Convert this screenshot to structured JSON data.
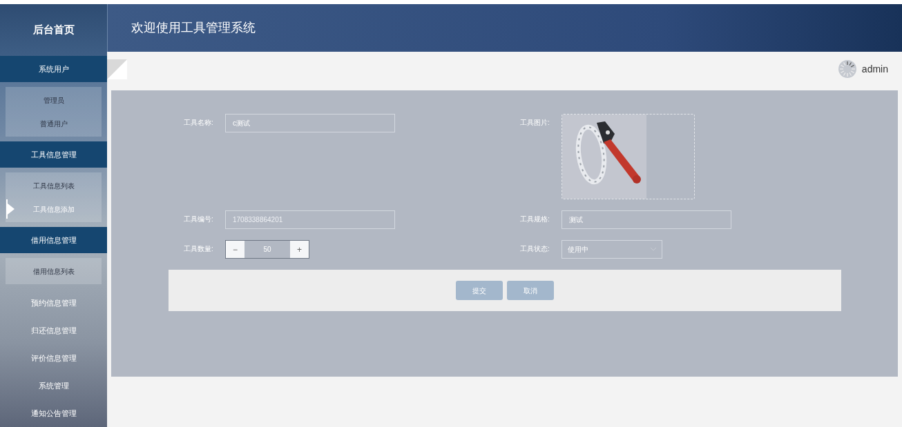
{
  "sidebar": {
    "title": "后台首页",
    "menu": [
      {
        "label": "系统用户",
        "expanded": true,
        "children": [
          {
            "label": "管理员",
            "selected": false
          },
          {
            "label": "普通用户",
            "selected": false
          }
        ]
      },
      {
        "label": "工具信息管理",
        "expanded": true,
        "children": [
          {
            "label": "工具信息列表",
            "selected": false
          },
          {
            "label": "工具信息添加",
            "selected": true
          }
        ]
      },
      {
        "label": "借用信息管理",
        "expanded": true,
        "children": [
          {
            "label": "借用信息列表",
            "selected": false
          }
        ]
      },
      {
        "label": "预约信息管理",
        "expanded": false
      },
      {
        "label": "归还信息管理",
        "expanded": false
      },
      {
        "label": "评价信息管理",
        "expanded": false
      },
      {
        "label": "系统管理",
        "expanded": false
      },
      {
        "label": "通知公告管理",
        "expanded": false
      }
    ]
  },
  "header": {
    "title": "欢迎使用工具管理系统",
    "user": "admin"
  },
  "form": {
    "rows": [
      [
        {
          "kind": "text",
          "label": "工具名称:",
          "value": "c测试",
          "disabled": false
        },
        {
          "kind": "picture",
          "label": "工具图片:"
        }
      ],
      [
        {
          "kind": "text",
          "label": "工具编号:",
          "value": "1708338864201",
          "disabled": true
        },
        {
          "kind": "text",
          "label": "工具规格:",
          "value": "测试",
          "disabled": false
        }
      ],
      [
        {
          "kind": "stepper",
          "label": "工具数量:",
          "value": "50",
          "minus": "−",
          "plus": "+"
        },
        {
          "kind": "select",
          "label": "工具状态:",
          "value": "使用中"
        }
      ]
    ],
    "buttons": [
      "提交",
      "取消"
    ]
  }
}
